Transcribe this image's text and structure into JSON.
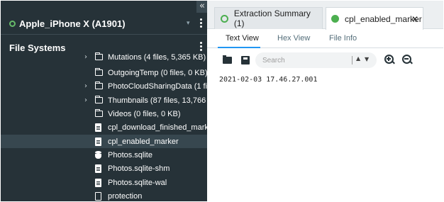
{
  "sidebar": {
    "collapse_glyph": "«",
    "device_name": "Apple_iPhone X (A1901)",
    "section_title": "File Systems",
    "tree": [
      {
        "label": "Mutations  (4 files, 5,365 KB)",
        "icon": "folder-icon",
        "expandable": true
      },
      {
        "label": "OutgoingTemp  (0 files, 0 KB)",
        "icon": "folder-icon",
        "expandable": false
      },
      {
        "label": "PhotoCloudSharingData  (1 file, 1",
        "icon": "folder-icon",
        "expandable": true
      },
      {
        "label": "Thumbnails  (87 files, 13,766 KB)",
        "icon": "folder-icon",
        "expandable": true
      },
      {
        "label": "Videos  (0 files, 0 KB)",
        "icon": "folder-icon",
        "expandable": false
      },
      {
        "label": "cpl_download_finished_marker",
        "icon": "file-icon",
        "expandable": false
      },
      {
        "label": "cpl_enabled_marker",
        "icon": "file-icon",
        "expandable": false,
        "selected": true
      },
      {
        "label": "Photos.sqlite",
        "icon": "database-icon",
        "expandable": false
      },
      {
        "label": "Photos.sqlite-shm",
        "icon": "file-icon",
        "expandable": false
      },
      {
        "label": "Photos.sqlite-wal",
        "icon": "file-icon",
        "expandable": false
      },
      {
        "label": "protection",
        "icon": "file-empty-icon",
        "expandable": false
      }
    ]
  },
  "tabs": [
    {
      "label": "Extraction Summary (1)",
      "active": false
    },
    {
      "label": "cpl_enabled_marker",
      "active": true
    }
  ],
  "viewer": {
    "subtabs": [
      "Text View",
      "Hex View",
      "File Info"
    ],
    "active_subtab": "Text View",
    "search_placeholder": "Search",
    "content_text": "2021-02-03 17.46.27.001"
  },
  "colors": {
    "sidebar_bg": "#263238",
    "accent_green": "#4caf50",
    "accent_blue": "#2196f3"
  }
}
